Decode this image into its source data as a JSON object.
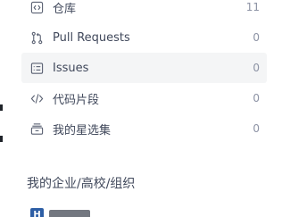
{
  "nav": {
    "items": [
      {
        "label": "仓库",
        "count": "11",
        "icon": "code-icon"
      },
      {
        "label": "Pull Requests",
        "count": "0",
        "icon": "pull-request-icon"
      },
      {
        "label": "Issues",
        "count": "0",
        "icon": "issues-icon",
        "active": true
      },
      {
        "label": "代码片段",
        "count": "0",
        "icon": "code-snippet-icon"
      },
      {
        "label": "我的星选集",
        "count": "0",
        "icon": "collection-icon"
      }
    ]
  },
  "organizations": {
    "title": "我的企业/高校/组织",
    "items": [
      {
        "avatar_letter": "H"
      }
    ]
  },
  "colors": {
    "text": "#40485b",
    "count": "#8c92a4",
    "active_bg": "#f4f5f6",
    "org_avatar": "#2d5ea5"
  }
}
